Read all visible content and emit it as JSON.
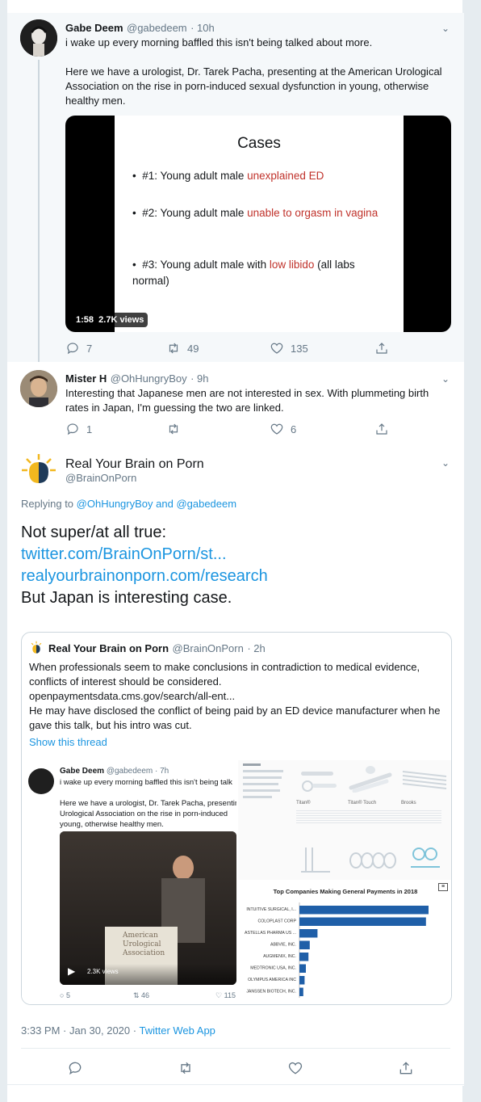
{
  "tweet1": {
    "name": "Gabe Deem",
    "handle": "@gabedeem",
    "time": "· 10h",
    "text1": "i wake up every morning baffled this isn't being talked about more.",
    "text2": "Here we have a urologist, Dr. Tarek Pacha, presenting at the American Urological Association on the rise in porn-induced sexual dysfunction in young, otherwise healthy men.",
    "video": {
      "slide_title": "Cases",
      "b1_pre": "#1: Young adult male ",
      "b1_red": "unexplained ED",
      "b2_pre": "#2: Young adult male ",
      "b2_red": "unable to orgasm in vagina",
      "b3_pre": "#3: Young adult male with ",
      "b3_red": "low libido",
      "b3_post": " (all labs normal)",
      "duration": "1:58",
      "views": "2.7K views"
    },
    "replies": "7",
    "retweets": "49",
    "likes": "135"
  },
  "tweet2": {
    "name": "Mister H",
    "handle": "@OhHungryBoy",
    "time": "· 9h",
    "text": "Interesting that Japanese men are not interested in sex. With plummeting birth rates in Japan, I'm guessing the two are linked.",
    "replies": "1",
    "retweets": "",
    "likes": "6"
  },
  "main": {
    "name": "Real Your Brain on Porn",
    "handle": "@BrainOnPorn",
    "replying_prefix": "Replying to ",
    "reply_to_1": "@OhHungryBoy",
    "reply_and": " and ",
    "reply_to_2": "@gabedeem",
    "line1": "Not super/at all true:",
    "link1": "twitter.com/BrainOnPorn/st...",
    "link2": "realyourbrainonporn.com/research",
    "line4": "But Japan is interesting case.",
    "timestamp": "3:33 PM · Jan 30, 2020",
    "sep": " · ",
    "client": "Twitter Web App"
  },
  "quote": {
    "name": "Real Your Brain on Porn",
    "handle": "@BrainOnPorn",
    "time": "· 2h",
    "text": "When professionals seem to make conclusions in contradiction to medical evidence, conflicts of interest should be considered.\nopenpaymentsdata.cms.gov/search/all-ent...\nHe may have disclosed the conflict of being paid by an ED device manufacturer when he gave this talk, but his intro was cut.",
    "show_thread": "Show this thread",
    "embedded": {
      "name": "Gabe Deem",
      "handle": "@gabedeem · 7h",
      "text1": "i wake up every morning baffled this isn't being talk",
      "text2": "Here we have a urologist, Dr. Tarek Pacha, presentin Urological Association on the rise in porn-induced young, otherwise healthy men.",
      "podium": "American Urological Association",
      "views": "2.3K views",
      "replies": "5",
      "retweets": "46",
      "likes": "115"
    },
    "products": [
      "Titan®",
      "Titan® Touch",
      "Brooks"
    ],
    "chart_title": "Top Companies Making General Payments in 2018"
  },
  "chart_data": {
    "type": "bar",
    "title": "Top Companies Making General Payments in 2018",
    "categories": [
      "INTUITIVE SURGICAL, I...",
      "COLOPLAST CORP",
      "ASTELLAS PHARMA US ...",
      "ABBVIE, INC.",
      "AUGMENIX, INC.",
      "MEDTRONIC USA, INC.",
      "OLYMPUS AMERICA INC",
      "JANSSEN BIOTECH, INC."
    ],
    "values": [
      100,
      98,
      14,
      8,
      7,
      5,
      4,
      3
    ],
    "color": "#1f5fa8"
  },
  "colors": {
    "accent": "#1b95e0",
    "text": "#14171a",
    "muted": "#657786",
    "bar": "#1f5fa8"
  }
}
